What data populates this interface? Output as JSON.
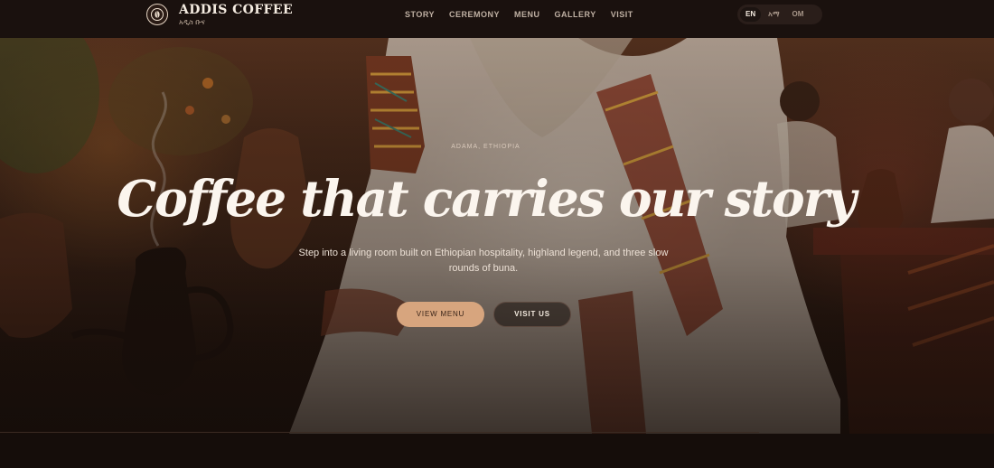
{
  "brand": {
    "name": "ADDIS COFFEE",
    "subtitle": "አዲስ ቡና",
    "logo_icon": "coffee-logo-icon"
  },
  "nav": {
    "items": [
      {
        "label": "STORY"
      },
      {
        "label": "CEREMONY"
      },
      {
        "label": "MENU"
      },
      {
        "label": "GALLERY"
      },
      {
        "label": "VISIT"
      }
    ]
  },
  "language": {
    "options": [
      {
        "label": "EN",
        "active": true
      },
      {
        "label": "አማ",
        "active": false
      },
      {
        "label": "OM",
        "active": false
      }
    ]
  },
  "hero": {
    "eyebrow": "ADAMA, ETHIOPIA",
    "headline": "Coffee that carries our story",
    "subtext": "Step into a living room built on Ethiopian hospitality, highland legend, and three slow rounds of buna.",
    "primary_cta": "VIEW MENU",
    "secondary_cta": "VISIT US"
  },
  "colors": {
    "accent": "#d7a57e",
    "background": "#1a110e",
    "text_light": "#fbf5ee"
  }
}
